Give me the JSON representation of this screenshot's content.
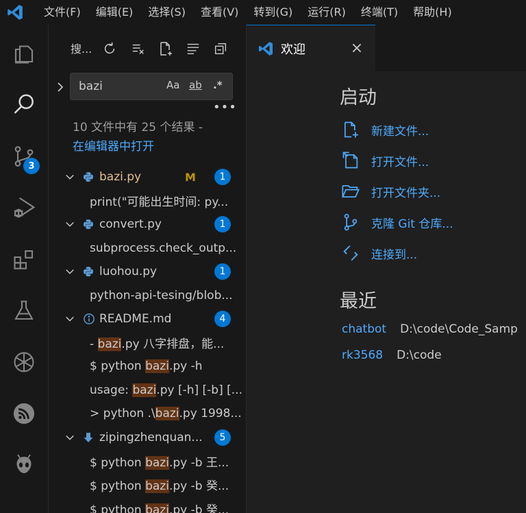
{
  "menu": {
    "items": [
      "文件(F)",
      "编辑(E)",
      "选择(S)",
      "查看(V)",
      "转到(G)",
      "运行(R)",
      "终端(T)",
      "帮助(H)"
    ]
  },
  "activity_bar": {
    "items": [
      "files-icon",
      "search-icon",
      "source-control-icon",
      "run-debug-icon",
      "extensions-icon",
      "testing-icon",
      "openai-icon",
      "rss-icon",
      "alien-icon"
    ],
    "source_control_badge": "3"
  },
  "search": {
    "title": "搜...",
    "query": "bazi",
    "match_case_label": "Aa",
    "whole_word_label": "ab",
    "regex_label": ".*",
    "summary_text": "10 文件中有 25 个结果 -",
    "open_in_editor_label": "在编辑器中打开",
    "results": [
      {
        "file": "bazi.py",
        "icon": "python-icon",
        "modified": "M",
        "count": "1",
        "matches": [
          {
            "pre": "print(\"可能出生时间: py...",
            "hit": "",
            "post": ""
          }
        ]
      },
      {
        "file": "convert.py",
        "icon": "python-icon",
        "modified": "",
        "count": "1",
        "matches": [
          {
            "pre": "subprocess.check_outp...",
            "hit": "",
            "post": ""
          }
        ]
      },
      {
        "file": "luohou.py",
        "icon": "python-icon",
        "modified": "",
        "count": "1",
        "matches": [
          {
            "pre": "python-api-tesing/blob...",
            "hit": "",
            "post": ""
          }
        ]
      },
      {
        "file": "README.md",
        "icon": "info-icon",
        "modified": "",
        "count": "4",
        "matches": [
          {
            "pre": "- ",
            "hit": "bazi",
            "post": ".py 八字排盘，能..."
          },
          {
            "pre": "$ python ",
            "hit": "bazi",
            "post": ".py -h"
          },
          {
            "pre": "usage: ",
            "hit": "bazi",
            "post": ".py [-h] [-b] [..."
          },
          {
            "pre": "> python .\\",
            "hit": "bazi",
            "post": ".py 1998..."
          }
        ]
      },
      {
        "file": "zipingzhenquan...",
        "icon": "markdown-download-icon",
        "modified": "",
        "count": "5",
        "matches": [
          {
            "pre": "$ python ",
            "hit": "bazi",
            "post": ".py -b 王..."
          },
          {
            "pre": "$ python ",
            "hit": "bazi",
            "post": ".py -b 癸..."
          },
          {
            "pre": "$ python ",
            "hit": "bazi",
            "post": ".py -b 癸..."
          }
        ]
      }
    ]
  },
  "tab": {
    "label": "欢迎"
  },
  "welcome": {
    "start_title": "启动",
    "start_items": [
      {
        "label": "新建文件...",
        "icon": "new-file-icon"
      },
      {
        "label": "打开文件...",
        "icon": "open-file-icon"
      },
      {
        "label": "打开文件夹...",
        "icon": "open-folder-icon"
      },
      {
        "label": "克隆 Git 仓库...",
        "icon": "git-clone-icon"
      },
      {
        "label": "连接到...",
        "icon": "remote-connect-icon"
      }
    ],
    "recent_title": "最近",
    "recent_items": [
      {
        "name": "chatbot",
        "path": "D:\\code\\Code_Samp"
      },
      {
        "name": "rk3568",
        "path": "D:\\code"
      }
    ]
  },
  "colors": {
    "accent": "#0078d4",
    "link": "#4daafc",
    "highlight": "#623315",
    "modified": "#e2c08d"
  }
}
